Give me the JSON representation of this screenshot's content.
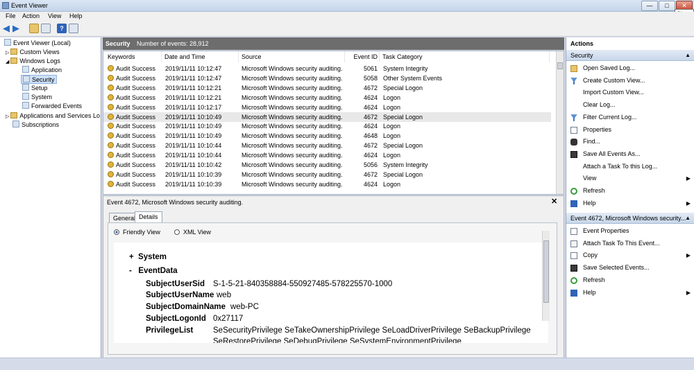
{
  "window": {
    "title": "Event Viewer",
    "close_tooltip": "Close"
  },
  "menu": [
    "File",
    "Action",
    "View",
    "Help"
  ],
  "tree": {
    "root": "Event Viewer (Local)",
    "custom_views": "Custom Views",
    "windows_logs": "Windows Logs",
    "logs": [
      "Application",
      "Security",
      "Setup",
      "System",
      "Forwarded Events"
    ],
    "apps_services": "Applications and Services Lo",
    "subscriptions": "Subscriptions"
  },
  "log_header": {
    "name": "Security",
    "count_label": "Number of events: 28,912"
  },
  "columns": [
    "Keywords",
    "Date and Time",
    "Source",
    "Event ID",
    "Task Category"
  ],
  "events": [
    {
      "kw": "Audit Success",
      "dt": "2019/11/11 10:12:47",
      "src": "Microsoft Windows security auditing.",
      "id": "5061",
      "cat": "System Integrity"
    },
    {
      "kw": "Audit Success",
      "dt": "2019/11/11 10:12:47",
      "src": "Microsoft Windows security auditing.",
      "id": "5058",
      "cat": "Other System Events"
    },
    {
      "kw": "Audit Success",
      "dt": "2019/11/11 10:12:21",
      "src": "Microsoft Windows security auditing.",
      "id": "4672",
      "cat": "Special Logon"
    },
    {
      "kw": "Audit Success",
      "dt": "2019/11/11 10:12:21",
      "src": "Microsoft Windows security auditing.",
      "id": "4624",
      "cat": "Logon"
    },
    {
      "kw": "Audit Success",
      "dt": "2019/11/11 10:12:17",
      "src": "Microsoft Windows security auditing.",
      "id": "4624",
      "cat": "Logon"
    },
    {
      "kw": "Audit Success",
      "dt": "2019/11/11 10:10:49",
      "src": "Microsoft Windows security auditing.",
      "id": "4672",
      "cat": "Special Logon"
    },
    {
      "kw": "Audit Success",
      "dt": "2019/11/11 10:10:49",
      "src": "Microsoft Windows security auditing.",
      "id": "4624",
      "cat": "Logon"
    },
    {
      "kw": "Audit Success",
      "dt": "2019/11/11 10:10:49",
      "src": "Microsoft Windows security auditing.",
      "id": "4648",
      "cat": "Logon"
    },
    {
      "kw": "Audit Success",
      "dt": "2019/11/11 10:10:44",
      "src": "Microsoft Windows security auditing.",
      "id": "4672",
      "cat": "Special Logon"
    },
    {
      "kw": "Audit Success",
      "dt": "2019/11/11 10:10:44",
      "src": "Microsoft Windows security auditing.",
      "id": "4624",
      "cat": "Logon"
    },
    {
      "kw": "Audit Success",
      "dt": "2019/11/11 10:10:42",
      "src": "Microsoft Windows security auditing.",
      "id": "5056",
      "cat": "System Integrity"
    },
    {
      "kw": "Audit Success",
      "dt": "2019/11/11 10:10:39",
      "src": "Microsoft Windows security auditing.",
      "id": "4672",
      "cat": "Special Logon"
    },
    {
      "kw": "Audit Success",
      "dt": "2019/11/11 10:10:39",
      "src": "Microsoft Windows security auditing.",
      "id": "4624",
      "cat": "Logon"
    }
  ],
  "detail": {
    "title": "Event 4672, Microsoft Windows security auditing.",
    "tabs": [
      "General",
      "Details"
    ],
    "view_options": [
      "Friendly View",
      "XML View"
    ],
    "system_label": "System",
    "eventdata_label": "EventData",
    "fields": [
      {
        "name": "SubjectUserSid",
        "value": "S-1-5-21-840358884-550927485-578225570-1000"
      },
      {
        "name": "SubjectUserName",
        "value": "web"
      },
      {
        "name": "SubjectDomainName",
        "value": "web-PC"
      },
      {
        "name": "SubjectLogonId",
        "value": "0x27117"
      },
      {
        "name": "PrivilegeList",
        "value": "SeSecurityPrivilege SeTakeOwnershipPrivilege SeLoadDriverPrivilege SeBackupPrivilege"
      }
    ],
    "privilege_cont": "SeRestorePrivilege SeDebugPrivilege SeSystemEnvironmentPrivilege"
  },
  "actions": {
    "title": "Actions",
    "section1": "Security",
    "items1": [
      {
        "label": "Open Saved Log...",
        "icon": "folder-open-icon",
        "sub": false
      },
      {
        "label": "Create Custom View...",
        "icon": "filter-icon",
        "sub": false
      },
      {
        "label": "Import Custom View...",
        "icon": "",
        "sub": false
      },
      {
        "label": "Clear Log...",
        "icon": "",
        "sub": false
      },
      {
        "label": "Filter Current Log...",
        "icon": "filter-icon",
        "sub": false
      },
      {
        "label": "Properties",
        "icon": "properties-icon",
        "sub": false
      },
      {
        "label": "Find...",
        "icon": "binoculars-icon",
        "sub": false
      },
      {
        "label": "Save All Events As...",
        "icon": "save-icon",
        "sub": false
      },
      {
        "label": "Attach a Task To this Log...",
        "icon": "",
        "sub": false
      },
      {
        "label": "View",
        "icon": "",
        "sub": true
      },
      {
        "label": "Refresh",
        "icon": "refresh-icon",
        "sub": false
      },
      {
        "label": "Help",
        "icon": "help-icon",
        "sub": true
      }
    ],
    "section2": "Event 4672, Microsoft Windows security...",
    "items2": [
      {
        "label": "Event Properties",
        "icon": "properties-icon",
        "sub": false
      },
      {
        "label": "Attach Task To This Event...",
        "icon": "task-icon",
        "sub": false
      },
      {
        "label": "Copy",
        "icon": "copy-icon",
        "sub": true
      },
      {
        "label": "Save Selected Events...",
        "icon": "save-icon",
        "sub": false
      },
      {
        "label": "Refresh",
        "icon": "refresh-icon",
        "sub": false
      },
      {
        "label": "Help",
        "icon": "help-icon",
        "sub": true
      }
    ]
  }
}
